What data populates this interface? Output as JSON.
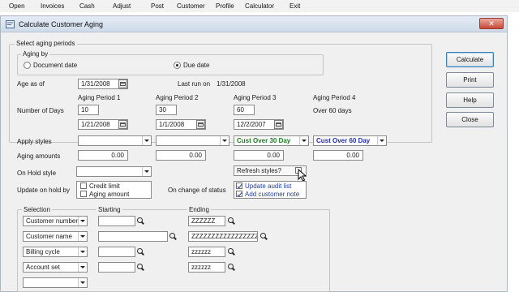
{
  "toolbar": [
    "Open",
    "Invoices",
    "Cash",
    "Adjust",
    "Post",
    "Customer",
    "Profile",
    "Calculator",
    "Exit"
  ],
  "window": {
    "title": "Calculate Customer Aging",
    "close_glyph": "✕"
  },
  "select_periods": {
    "group_title": "Select aging periods",
    "aging_by_title": "Aging by",
    "document_date": "Document date",
    "due_date": "Due date",
    "selected": "due_date"
  },
  "age_as_of": {
    "label": "Age as of",
    "value": "1/31/2008"
  },
  "last_run": {
    "label": "Last run on",
    "value": "1/31/2008"
  },
  "periods": {
    "headers": [
      "Aging Period 1",
      "Aging Period 2",
      "Aging Period 3",
      "Aging Period 4"
    ],
    "days_label": "Number of Days",
    "days": [
      "10",
      "30",
      "60"
    ],
    "over_label": "Over 60 days",
    "dates": [
      "1/21/2008",
      "1/1/2008",
      "12/2/2007"
    ]
  },
  "apply_styles": {
    "label": "Apply styles",
    "values": [
      "",
      "",
      "Cust Over 30 Day",
      "Cust Over 60 Day"
    ]
  },
  "aging_amounts": {
    "label": "Aging amounts",
    "values": [
      "0.00",
      "0.00",
      "0.00",
      "0.00"
    ]
  },
  "on_hold_style": {
    "label": "On Hold style",
    "value": ""
  },
  "refresh_styles": {
    "label": "Refresh styles?"
  },
  "update_on_hold": {
    "label": "Update on hold by",
    "credit_limit": "Credit limit",
    "aging_amount": "Aging amount"
  },
  "on_change_status": {
    "label": "On change of status",
    "update_audit_list": "Update audit list",
    "add_customer_note": "Add customer note"
  },
  "selection": {
    "headers": {
      "selection": "Selection",
      "starting": "Starting",
      "ending": "Ending"
    },
    "rows": [
      {
        "field": "Customer number",
        "start": "",
        "end": "ZZZZZZ"
      },
      {
        "field": "Customer name",
        "start": "",
        "end": "ZZZZZZZZZZZZZZZZZZZZ"
      },
      {
        "field": "Billing cycle",
        "start": "",
        "end": "zzzzzz"
      },
      {
        "field": "Account set",
        "start": "",
        "end": "zzzzzz"
      },
      {
        "field": "",
        "start": "",
        "end": ""
      }
    ]
  },
  "buttons": [
    "Calculate",
    "Print",
    "Help",
    "Close"
  ]
}
